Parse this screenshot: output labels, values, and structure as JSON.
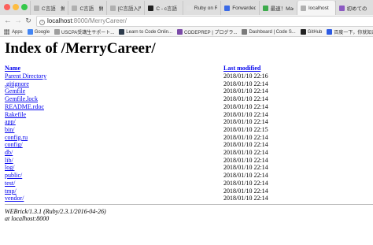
{
  "browser": {
    "tabs": [
      {
        "label": "C言語　鮮",
        "favicon_color": "#b0b0b0"
      },
      {
        "label": "C言語　鮮",
        "favicon_color": "#b0b0b0"
      },
      {
        "label": "[C言語入門",
        "favicon_color": "#b0b0b0"
      },
      {
        "label": "C - c言語",
        "favicon_color": "#1f1f1f"
      },
      {
        "label": "Ruby on R",
        "favicon_color": "#e0e0e0"
      },
      {
        "label": "Forwarded",
        "favicon_color": "#3b6ae6"
      },
      {
        "label": "最速！Mac",
        "favicon_color": "#3dab4c"
      },
      {
        "label": "localhost",
        "favicon_color": "#b0b0b0"
      },
      {
        "label": "初めての ",
        "favicon_color": "#8c5ac2"
      }
    ],
    "address": {
      "host": "localhost",
      "rest": ":8000/MerryCareer/"
    },
    "bookmarks": [
      {
        "label": "Apps",
        "icon": "apps-grid-icon",
        "color": "#555555"
      },
      {
        "label": "Google",
        "icon": "google-icon",
        "color": "#4285f4"
      },
      {
        "label": "USCPA受講生サポート...",
        "icon": "file-icon",
        "color": "#9e9e9e"
      },
      {
        "label": "Learn to Code Onlin...",
        "icon": "codecademy-icon",
        "color": "#2d3b4c"
      },
      {
        "label": "CODEPREP | プログラ...",
        "icon": "codeprep-icon",
        "color": "#7a4aa8"
      },
      {
        "label": "Dashboard | Code S...",
        "icon": "globe-icon",
        "color": "#7a7a7a"
      },
      {
        "label": "GitHub",
        "icon": "github-icon",
        "color": "#222222"
      },
      {
        "label": "百度一下，你就知道",
        "icon": "baidu-icon",
        "color": "#2d5be3"
      }
    ]
  },
  "page": {
    "title": "Index of /MerryCareer/",
    "headers": {
      "name": "Name",
      "modified": "Last modified"
    },
    "entries": [
      {
        "name": "Parent Directory",
        "modified": "2018/01/10 22:16"
      },
      {
        "name": ".gitignore",
        "modified": "2018/01/10 22:14"
      },
      {
        "name": "Gemfile",
        "modified": "2018/01/10 22:14"
      },
      {
        "name": "Gemfile.lock",
        "modified": "2018/01/10 22:14"
      },
      {
        "name": "README.rdoc",
        "modified": "2018/01/10 22:14"
      },
      {
        "name": "Rakefile",
        "modified": "2018/01/10 22:14"
      },
      {
        "name": "app/",
        "modified": "2018/01/10 22:14"
      },
      {
        "name": "bin/",
        "modified": "2018/01/10 22:15"
      },
      {
        "name": "config.ru",
        "modified": "2018/01/10 22:14"
      },
      {
        "name": "config/",
        "modified": "2018/01/10 22:14"
      },
      {
        "name": "db/",
        "modified": "2018/01/10 22:14"
      },
      {
        "name": "lib/",
        "modified": "2018/01/10 22:14"
      },
      {
        "name": "log/",
        "modified": "2018/01/10 22:14"
      },
      {
        "name": "public/",
        "modified": "2018/01/10 22:14"
      },
      {
        "name": "test/",
        "modified": "2018/01/10 22:14"
      },
      {
        "name": "tmp/",
        "modified": "2018/01/10 22:14"
      },
      {
        "name": "vendor/",
        "modified": "2018/01/10 22:14"
      }
    ],
    "footer": {
      "server": "WEBrick/1.3.1 (Ruby/2.3.1/2016-04-26)",
      "location": "at localhost:8000"
    }
  }
}
